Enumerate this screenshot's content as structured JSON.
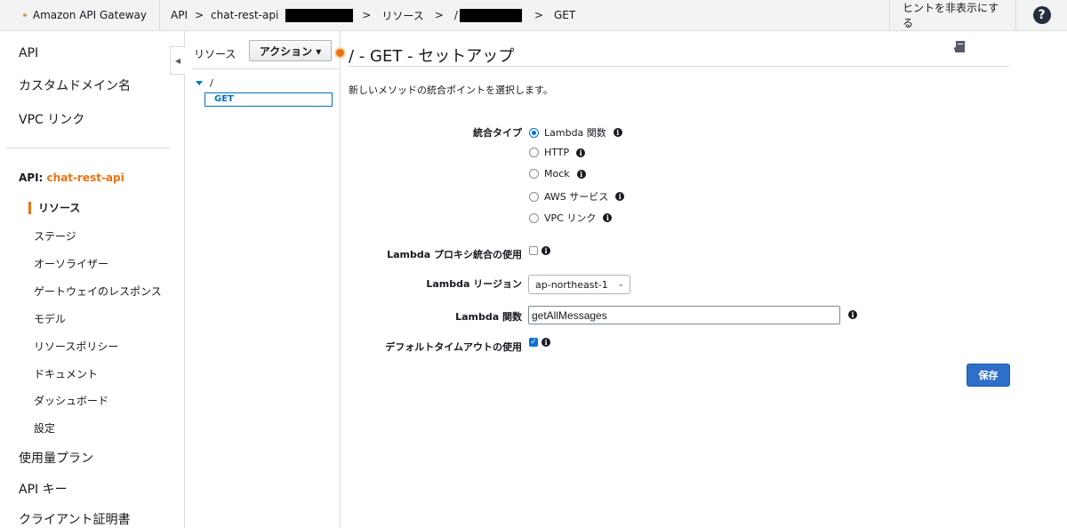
{
  "topbar": {
    "brand": "Amazon API Gateway",
    "crumbs": [
      "API",
      ">",
      "chat-rest-api",
      ">",
      "リソース",
      ">",
      "/",
      ">",
      "GET"
    ],
    "hint_label": "ヒントを非表示にする",
    "help_label": "?"
  },
  "leftnav": {
    "top_items": [
      "API",
      "カスタムドメイン名",
      "VPC リンク"
    ],
    "api_prefix": "API:",
    "api_name": "chat-rest-api",
    "sub_items": [
      "リソース",
      "ステージ",
      "オーソライザー",
      "ゲートウェイのレスポンス",
      "モデル",
      "リソースポリシー",
      "ドキュメント",
      "ダッシュボード",
      "設定"
    ],
    "bottom_items": [
      "使用量プラン",
      "API キー",
      "クライアント証明書"
    ]
  },
  "resources": {
    "label": "リソース",
    "action_label": "アクション ▾",
    "root": "/",
    "method": "GET"
  },
  "main": {
    "title": "/ - GET - セットアップ",
    "intro": "新しいメソッドの統合ポイントを選択します。",
    "integration_type_label": "統合タイプ",
    "integration_options": [
      "Lambda 関数",
      "HTTP",
      "Mock",
      "AWS サービス",
      "VPC リンク"
    ],
    "selected_option": "Lambda 関数",
    "proxy_label": "Lambda プロキシ統合の使用",
    "proxy_checked": false,
    "region_label": "Lambda リージョン",
    "region_value": "ap-northeast-1",
    "function_label": "Lambda 関数",
    "function_value": "getAllMessages",
    "timeout_label": "デフォルトタイムアウトの使用",
    "timeout_checked": true,
    "save_label": "保存"
  },
  "colors": {
    "accent": "#ec7211",
    "link": "#0073bb",
    "primary": "#2e6fc9"
  }
}
